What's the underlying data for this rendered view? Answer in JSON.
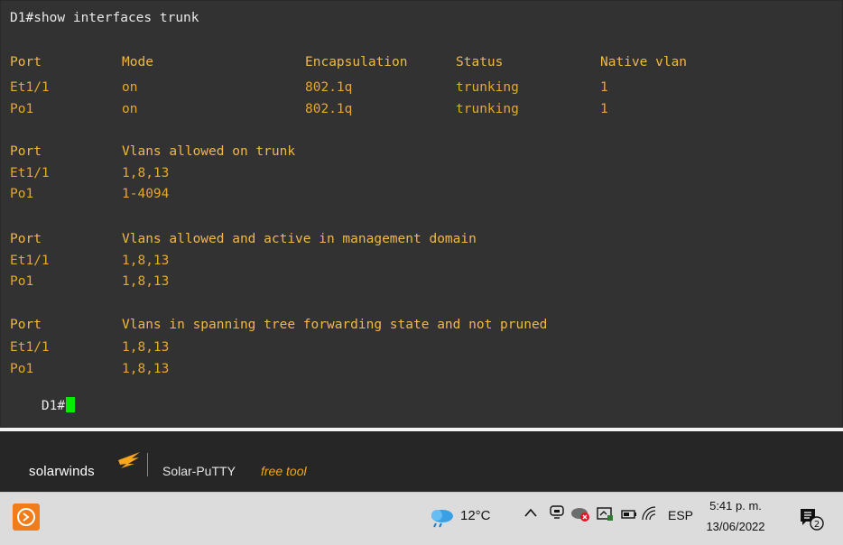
{
  "terminal": {
    "command_line": "D1#show interfaces trunk",
    "section1": {
      "headers": [
        "Port",
        "Mode",
        "Encapsulation",
        "Status",
        "Native vlan"
      ],
      "rows": [
        [
          "Et1/1",
          "on",
          "802.1q",
          "trunking",
          "1"
        ],
        [
          "Po1",
          "on",
          "802.1q",
          "trunking",
          "1"
        ]
      ]
    },
    "section2": {
      "headers": [
        "Port",
        "Vlans allowed on trunk"
      ],
      "rows": [
        [
          "Et1/1",
          "1,8,13"
        ],
        [
          "Po1",
          "1-4094"
        ]
      ]
    },
    "section3": {
      "headers": [
        "Port",
        "Vlans allowed and active in management domain"
      ],
      "rows": [
        [
          "Et1/1",
          "1,8,13"
        ],
        [
          "Po1",
          "1,8,13"
        ]
      ]
    },
    "section4": {
      "headers": [
        "Port",
        "Vlans in spanning tree forwarding state and not pruned"
      ],
      "rows": [
        [
          "Et1/1",
          "1,8,13"
        ],
        [
          "Po1",
          "1,8,13"
        ]
      ]
    },
    "prompt": "D1#"
  },
  "brand": {
    "logo_text": "solarwinds",
    "app_name": "Solar-PuTTY",
    "free_label": "free tool"
  },
  "taskbar": {
    "app_icon": "solar-putty-icon",
    "temperature": "12°C",
    "language": "ESP",
    "time": "5:41 p. m.",
    "date": "13/06/2022",
    "notifications_count": "2"
  },
  "colors": {
    "terminal_bg": "#323232",
    "terminal_text": "#e5a82a",
    "cursor": "#00ee00",
    "brand_accent": "#f7a51b"
  }
}
